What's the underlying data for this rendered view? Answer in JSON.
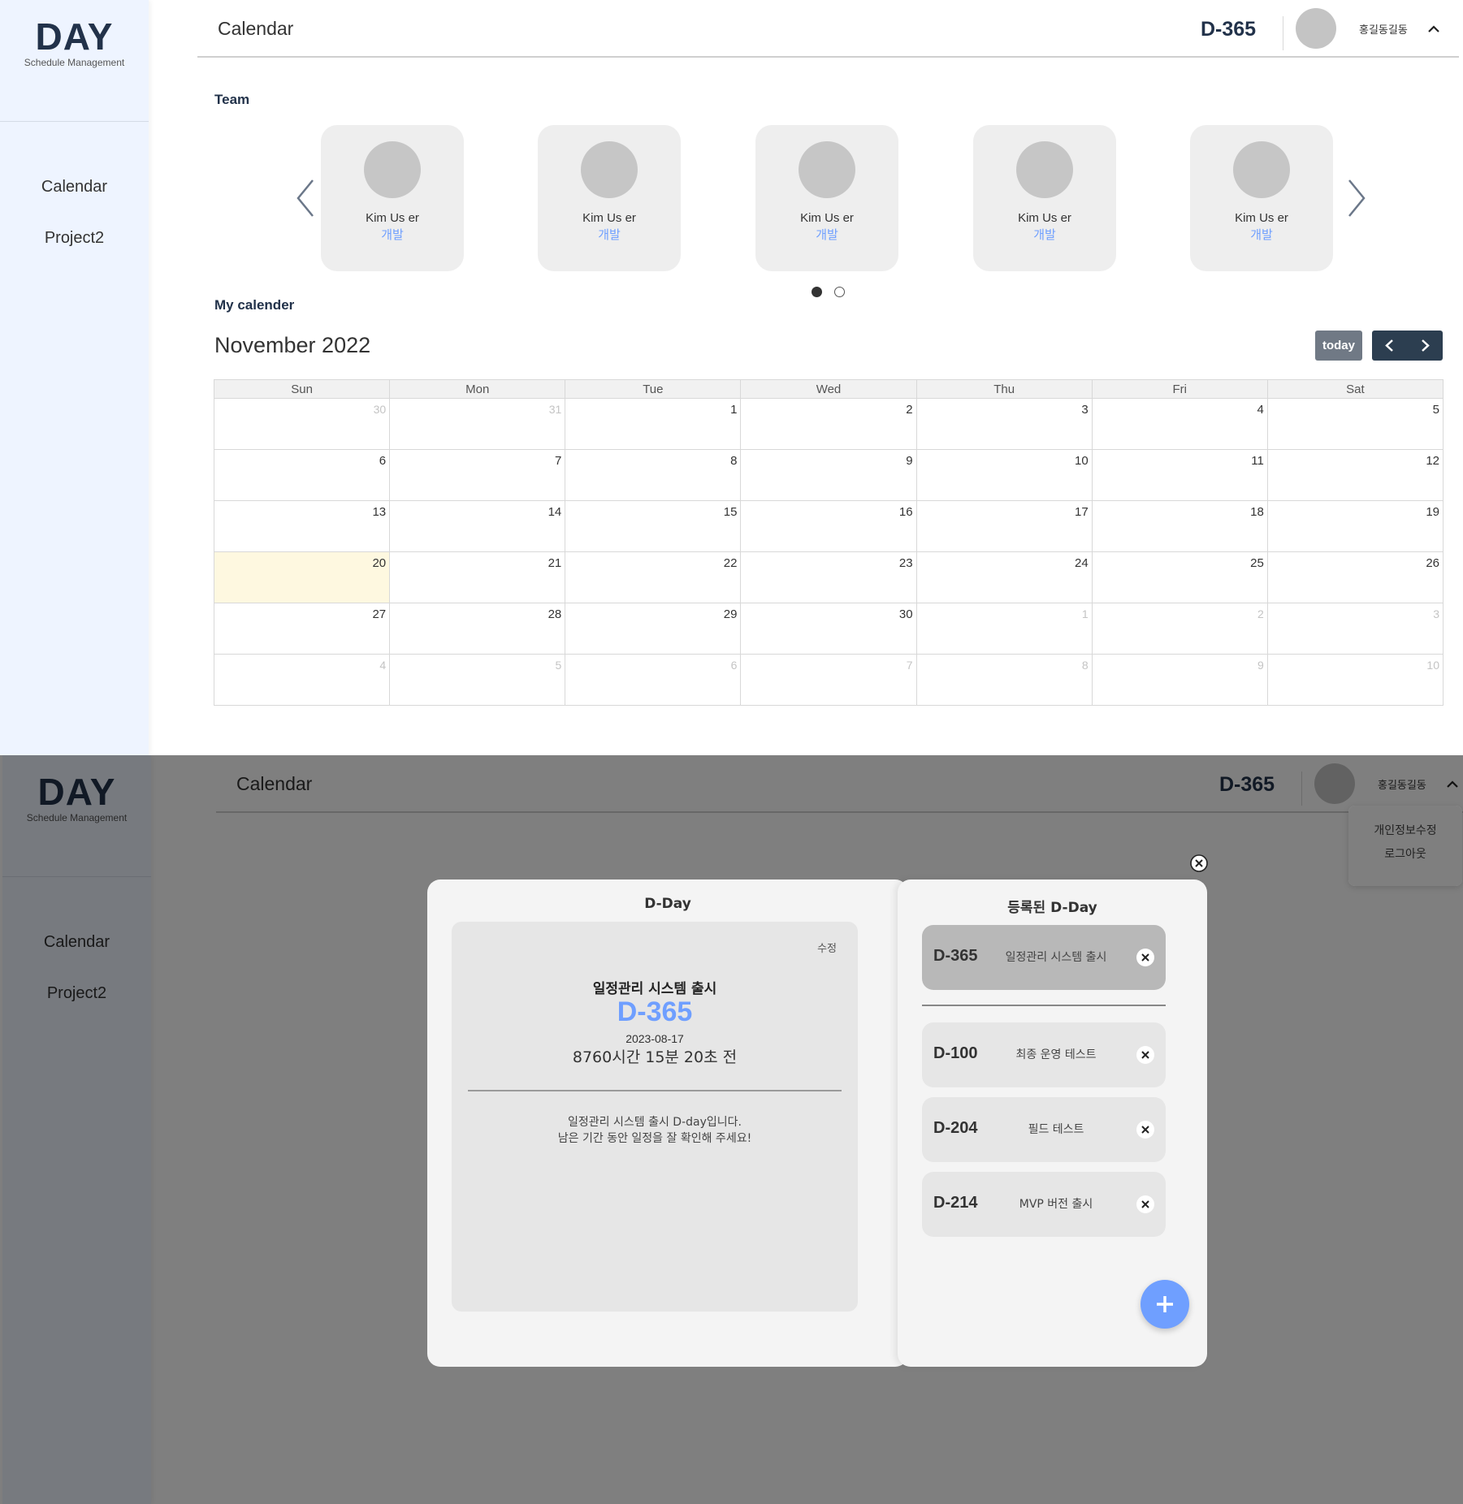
{
  "app": {
    "logo_title": "DAY",
    "logo_subtitle": "Schedule Management",
    "nav": [
      {
        "label": "Calendar"
      },
      {
        "label": "Project2"
      }
    ]
  },
  "header": {
    "title": "Calendar",
    "dday": "D-365",
    "user_name": "홍길동길동",
    "user_menu": [
      "개인정보수정",
      "로그아웃"
    ]
  },
  "team": {
    "label": "Team",
    "members": [
      {
        "name": "Kim Us er",
        "role": "개발"
      },
      {
        "name": "Kim Us er",
        "role": "개발"
      },
      {
        "name": "Kim Us er",
        "role": "개발"
      },
      {
        "name": "Kim Us er",
        "role": "개발"
      },
      {
        "name": "Kim Us er",
        "role": "개발"
      }
    ],
    "page_count": 2,
    "active_page": 1
  },
  "calendar": {
    "label": "My calender",
    "month_title": "November 2022",
    "today_label": "today",
    "weekdays": [
      "Sun",
      "Mon",
      "Tue",
      "Wed",
      "Thu",
      "Fri",
      "Sat"
    ],
    "weeks": [
      [
        {
          "d": "30",
          "o": true
        },
        {
          "d": "31",
          "o": true
        },
        {
          "d": "1"
        },
        {
          "d": "2"
        },
        {
          "d": "3"
        },
        {
          "d": "4"
        },
        {
          "d": "5"
        }
      ],
      [
        {
          "d": "6"
        },
        {
          "d": "7"
        },
        {
          "d": "8"
        },
        {
          "d": "9"
        },
        {
          "d": "10"
        },
        {
          "d": "11"
        },
        {
          "d": "12"
        }
      ],
      [
        {
          "d": "13"
        },
        {
          "d": "14"
        },
        {
          "d": "15"
        },
        {
          "d": "16"
        },
        {
          "d": "17"
        },
        {
          "d": "18"
        },
        {
          "d": "19"
        }
      ],
      [
        {
          "d": "20",
          "t": true
        },
        {
          "d": "21"
        },
        {
          "d": "22"
        },
        {
          "d": "23"
        },
        {
          "d": "24"
        },
        {
          "d": "25"
        },
        {
          "d": "26"
        }
      ],
      [
        {
          "d": "27"
        },
        {
          "d": "28"
        },
        {
          "d": "29"
        },
        {
          "d": "30"
        },
        {
          "d": "1",
          "o": true
        },
        {
          "d": "2",
          "o": true
        },
        {
          "d": "3",
          "o": true
        }
      ],
      [
        {
          "d": "4",
          "o": true
        },
        {
          "d": "5",
          "o": true
        },
        {
          "d": "6",
          "o": true
        },
        {
          "d": "7",
          "o": true
        },
        {
          "d": "8",
          "o": true
        },
        {
          "d": "9",
          "o": true
        },
        {
          "d": "10",
          "o": true
        }
      ]
    ]
  },
  "dday_modal": {
    "left_heading": "D-Day",
    "edit_label": "수정",
    "detail": {
      "title": "일정관리 시스템 출시",
      "dday": "D-365",
      "date": "2023-08-17",
      "remaining": "8760시간 15분 20초 전",
      "desc_line1": "일정관리 시스템 출시 D-day입니다.",
      "desc_line2": "남은 기간 동안 일정을 잘 확인해 주세요!"
    },
    "right_heading": "등록된 D-Day",
    "items": [
      {
        "code": "D-365",
        "name": "일정관리 시스템 출시",
        "selected": true
      },
      {
        "code": "D-100",
        "name": "최종 운영 테스트"
      },
      {
        "code": "D-204",
        "name": "필드 테스트"
      },
      {
        "code": "D-214",
        "name": "MVP 버전 출시"
      }
    ]
  },
  "colors": {
    "accent": "#6f9fff",
    "dark": "#2c3e50",
    "sidebar_bg": "#eef4ff",
    "today_bg": "#fef8e0",
    "overlay": "rgba(0,0,0,0.5)"
  }
}
